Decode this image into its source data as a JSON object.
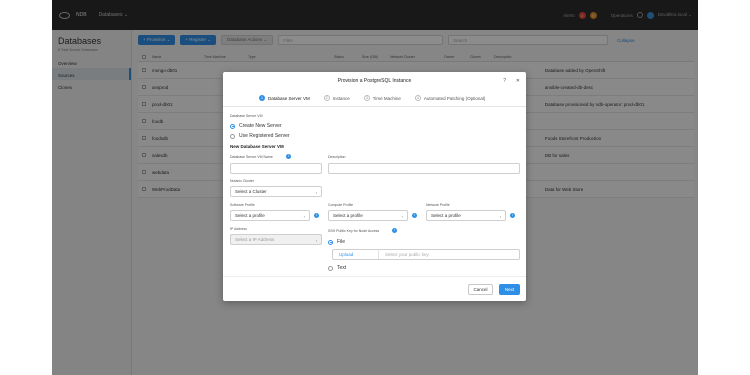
{
  "topbar": {
    "brand": "NDB",
    "menu": "Databases ⌄",
    "alerts_label": "Alerts",
    "alerts_count": "2",
    "alerts_count2": "0",
    "operations_label": "Operations",
    "user": "Davidlitra.local ⌄",
    "colors": {
      "bg": "#2d2d2d",
      "accent": "#2f8fe6"
    }
  },
  "leftnav": {
    "title": "Databases",
    "subtitle": "8 Total Source Databases",
    "items": [
      {
        "label": "Overview",
        "active": false
      },
      {
        "label": "Sources",
        "active": true
      },
      {
        "label": "Clones",
        "active": false
      }
    ]
  },
  "toolbar": {
    "provision_label": "+ Provision ⌄",
    "register_label": "+ Register ⌄",
    "actions_label": "Database Actions ⌄",
    "filter_placeholder": "Filter",
    "search_placeholder": "Search",
    "collapse_label": "Collapse"
  },
  "table": {
    "headers": [
      "Name",
      "Time Machine",
      "Type",
      "Status",
      "Size (GiB)",
      "Network Cluster",
      "Owner",
      "Clones",
      "Description"
    ],
    "rows": [
      {
        "name": "mongo-db01",
        "description": "Database added by OpenShift"
      },
      {
        "name": "ansprod",
        "description": "ansible-created-db-desc"
      },
      {
        "name": "prod-db01",
        "description": "Database provisioned by ndb-operator: prod-db01"
      },
      {
        "name": "foodb",
        "description": ""
      },
      {
        "name": "foodsdb",
        "description": "Foods Storefront Production"
      },
      {
        "name": "salesdb",
        "description": "DB for sales"
      },
      {
        "name": "webdata",
        "description": ""
      },
      {
        "name": "WebProdData",
        "description": "Data for Web Store"
      }
    ]
  },
  "modal": {
    "title": "Provision a PostgreSQL Instance",
    "help": "?",
    "close": "✕",
    "steps": [
      {
        "num": "1",
        "label": "Database Server VM",
        "active": true
      },
      {
        "num": "2",
        "label": "Instance",
        "active": false
      },
      {
        "num": "3",
        "label": "Time Machine",
        "active": false
      },
      {
        "num": "4",
        "label": "Automated Patching (Optional)",
        "active": false
      }
    ],
    "server_vm_label": "Database Server VM",
    "radio_create": "Create New Server",
    "radio_registered": "Use Registered Server",
    "new_server_heading": "New Database Server VM",
    "vm_name_label": "Database Server VM Name",
    "vm_name_value": "",
    "description_label": "Description",
    "description_value": "",
    "cluster_label": "Nutanix Cluster",
    "cluster_value": "Select a Cluster",
    "software_label": "Software Profile",
    "software_value": "Select a profile",
    "compute_label": "Compute Profile",
    "compute_value": "Select a profile",
    "network_label": "Network Profile",
    "network_value": "Select a profile",
    "ip_label": "IP Address",
    "ip_value": "Select a IP Address",
    "ssh_label": "SSH Public Key for Node Access",
    "ssh_file": "File",
    "ssh_text": "Text",
    "upload_link": "Upload",
    "upload_placeholder": "Select your public key",
    "cancel_label": "Cancel",
    "next_label": "Next"
  }
}
